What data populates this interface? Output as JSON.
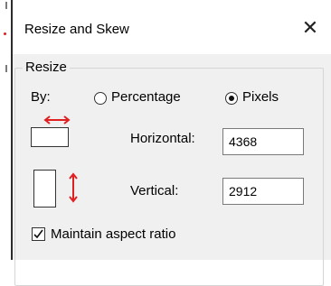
{
  "dialog": {
    "title": "Resize and Skew",
    "close_glyph": "✕"
  },
  "resize": {
    "group_label": "Resize",
    "by_label": "By:",
    "options": [
      {
        "label": "Percentage",
        "selected": false
      },
      {
        "label": "Pixels",
        "selected": true
      }
    ],
    "horizontal_label": "Horizontal:",
    "horizontal_value": "4368",
    "vertical_label": "Vertical:",
    "vertical_value": "2912",
    "maintain_aspect_label": "Maintain aspect ratio",
    "maintain_aspect_checked": true
  },
  "icons": {
    "horizontal": "horizontal-resize-icon",
    "vertical": "vertical-resize-icon",
    "close": "close-icon"
  },
  "colors": {
    "arrow": "#e02020",
    "dialog_bg": "#f0f0f0"
  }
}
